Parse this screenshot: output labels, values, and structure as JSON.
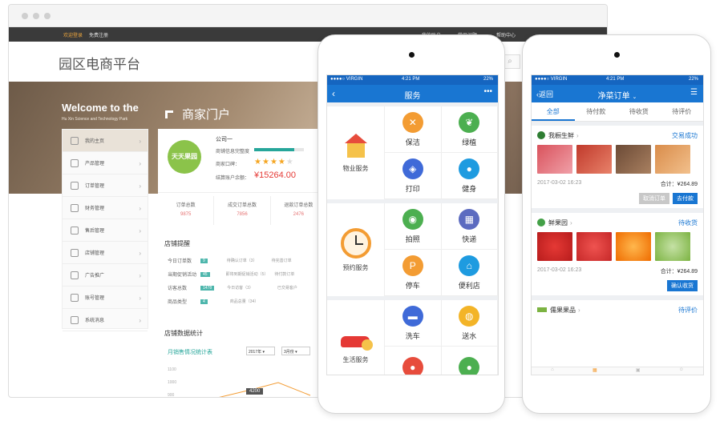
{
  "browser": {
    "topnav": {
      "left_link": "欢迎登录",
      "left_sep": "免费注册",
      "right1": "我的账户",
      "right2": "常见问题",
      "right3": "帮助中心"
    },
    "site_title": "园区电商平台",
    "hero": {
      "welcome": "Welcome to the",
      "subtitle": "Hu Xin Science and Technology Park",
      "portal": "商家门户"
    },
    "sidebar": [
      {
        "label": "我的主页"
      },
      {
        "label": "产品管理"
      },
      {
        "label": "订单管理"
      },
      {
        "label": "财务管理"
      },
      {
        "label": "售后管理"
      },
      {
        "label": "店铺管理"
      },
      {
        "label": "广告推广"
      },
      {
        "label": "账号管理"
      },
      {
        "label": "系统消息"
      }
    ],
    "company": {
      "logo_text": "天天果园",
      "name": "公司一",
      "progress_label": "商铺信息完整度",
      "rating_label": "商家口碑：",
      "balance_label": "结算账户余额：",
      "balance": "¥15264.00",
      "progress": 0.8,
      "stars": 4
    },
    "stats": [
      {
        "label": "订单总数",
        "value": "9875"
      },
      {
        "label": "成交订单总数",
        "value": "7856"
      },
      {
        "label": "退款订单总数",
        "value": "2476"
      }
    ],
    "reminder": {
      "title": "店铺提醒",
      "rows": [
        {
          "label": "今日订单数",
          "badge": "9",
          "mid": "待确认订单（3）",
          "right": "待完善订单"
        },
        {
          "label": "当期促销活动",
          "badge": "45",
          "mid": "即将到期促销活动（5）",
          "right": "待付款订单"
        },
        {
          "label": "访客总数",
          "badge": "1478",
          "mid": "今日访客（3）",
          "right": "已交易客户"
        },
        {
          "label": "商品类型",
          "badge": "4",
          "mid": "商品总量（34）",
          "right": ""
        }
      ]
    },
    "stats_section": {
      "title": "店铺数据统计",
      "chart_title": "月销售情况统计表",
      "year": "2017年",
      "month": "3月份",
      "y_ticks": [
        "1100",
        "1000",
        "900"
      ],
      "tooltip": "4200"
    }
  },
  "phone1": {
    "status": {
      "carrier": "●●●●○ VIRGIN",
      "time": "4:21 PM",
      "battery": "22%"
    },
    "title": "服务",
    "groups": [
      {
        "name": "物业服务",
        "items": [
          {
            "label": "保洁",
            "color": "#f39c33"
          },
          {
            "label": "绿植",
            "color": "#4caf50"
          },
          {
            "label": "打印",
            "color": "#3f6ad8"
          },
          {
            "label": "健身",
            "color": "#1e9be0"
          }
        ]
      },
      {
        "name": "预约服务",
        "items": [
          {
            "label": "拍照",
            "color": "#4caf50"
          },
          {
            "label": "快递",
            "color": "#5c6bc0"
          },
          {
            "label": "停车",
            "color": "#f39c33"
          },
          {
            "label": "便利店",
            "color": "#1e9be0"
          }
        ]
      },
      {
        "name": "生活服务",
        "items": [
          {
            "label": "洗车",
            "color": "#3f6ad8"
          },
          {
            "label": "送水",
            "color": "#f3b428"
          },
          {
            "label": "",
            "color": "#e74c3c"
          },
          {
            "label": "",
            "color": "#4caf50"
          }
        ]
      }
    ]
  },
  "phone2": {
    "status": {
      "carrier": "●●●●○ VIRGIN",
      "time": "4:21 PM",
      "battery": "22%"
    },
    "back": "返回",
    "title": "净菜订单",
    "tabs": [
      "全部",
      "待付款",
      "待收货",
      "待评价"
    ],
    "orders": [
      {
        "shop": "我橱生鲜",
        "status": "交易成功",
        "date": "2017-03-02 16:23",
        "total": "合计：¥264.89",
        "btn1": "取消订单",
        "btn2": "去付款"
      },
      {
        "shop": "鲜果园",
        "status": "待收货",
        "date": "2017-03-02 16:23",
        "total": "合计：¥264.89",
        "btn1": "",
        "btn2": "确认收货"
      },
      {
        "shop": "儒果果品",
        "status": "待评价",
        "date": "",
        "total": "",
        "btn1": "",
        "btn2": ""
      }
    ]
  }
}
